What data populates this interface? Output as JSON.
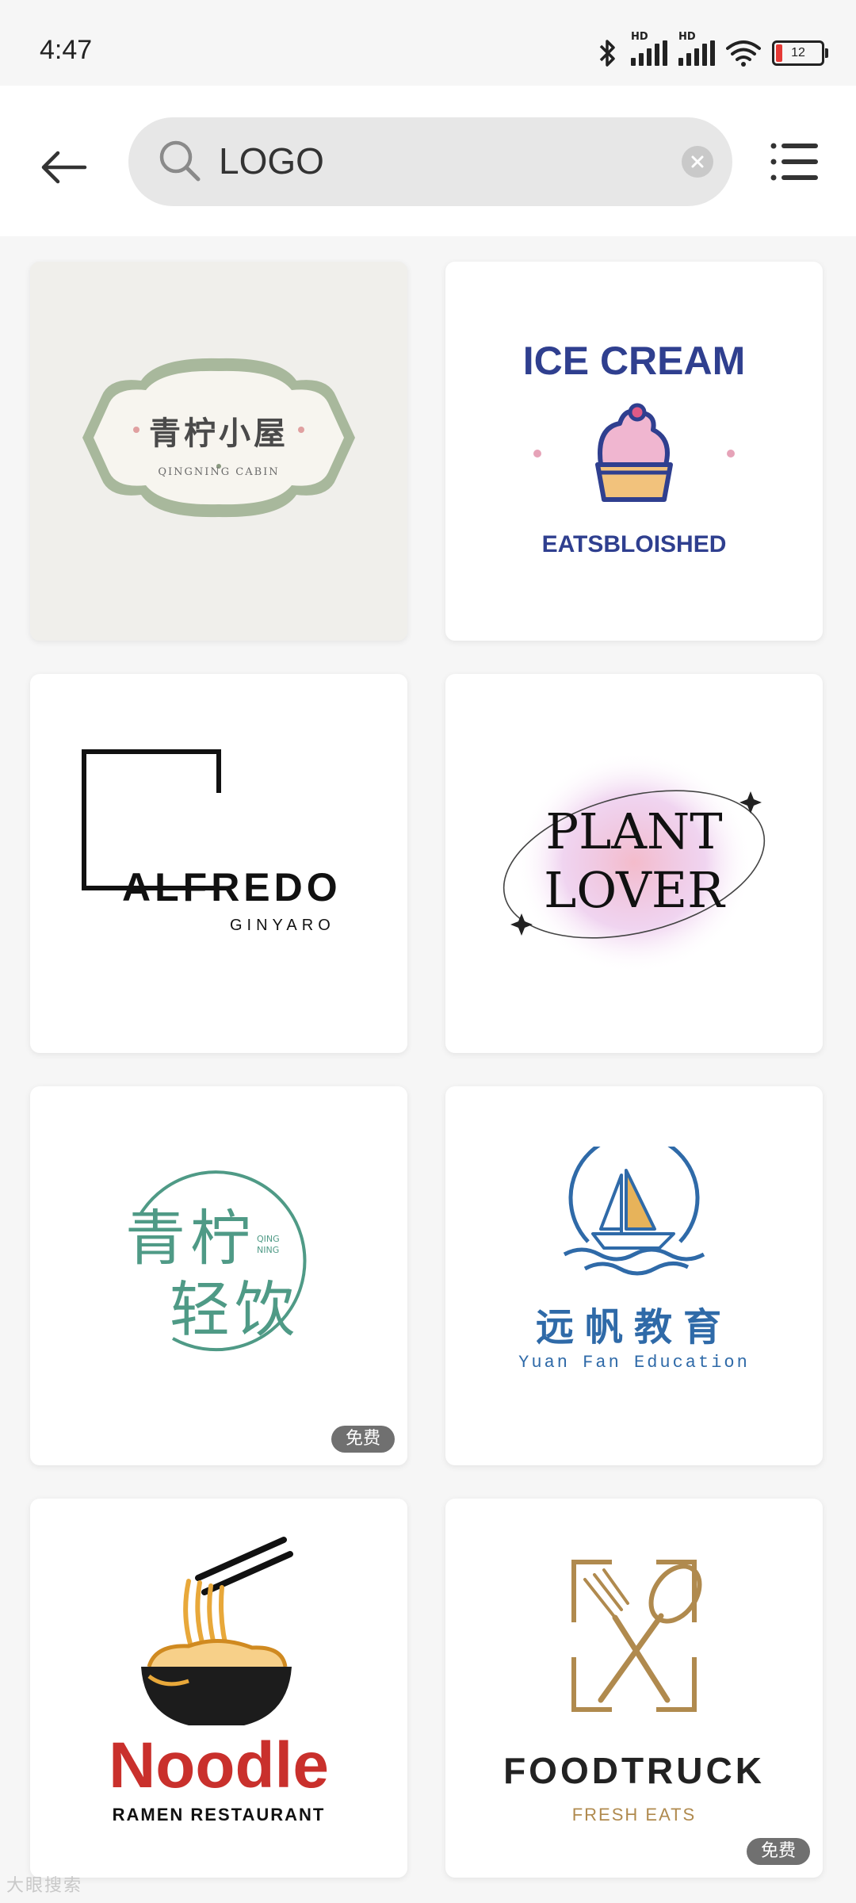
{
  "status": {
    "time": "4:47",
    "battery": "12"
  },
  "search": {
    "query": "LOGO",
    "back_icon": "arrow-left-icon",
    "search_icon": "search-icon",
    "clear_icon": "clear-icon",
    "menu_icon": "list-menu-icon"
  },
  "cards": [
    {
      "name": "qingning-cabin",
      "title": "青柠小屋",
      "subtitle": "QINGNING CABIN",
      "badge": ""
    },
    {
      "name": "ice-cream",
      "title": "ICE CREAM",
      "subtitle": "EATSBLOISHED",
      "badge": ""
    },
    {
      "name": "alfredo",
      "title": "ALFREDO",
      "subtitle": "GINYARO",
      "badge": ""
    },
    {
      "name": "plant-lover",
      "title": "PLANT",
      "subtitle": "LOVER",
      "badge": ""
    },
    {
      "name": "qingning-drinks",
      "title": "青柠",
      "subtitle": "轻饮",
      "tag_top": "QING",
      "tag_bottom": "NING",
      "badge": "免费"
    },
    {
      "name": "yuanfan-education",
      "title": "远帆教育",
      "subtitle": "Yuan Fan Education",
      "badge": ""
    },
    {
      "name": "noodle",
      "title": "Noodle",
      "subtitle": "RAMEN RESTAURANT",
      "badge": ""
    },
    {
      "name": "foodtruck",
      "title": "FOODTRUCK",
      "subtitle": "FRESH EATS",
      "badge": "免费"
    }
  ],
  "watermark": "大眼搜索"
}
